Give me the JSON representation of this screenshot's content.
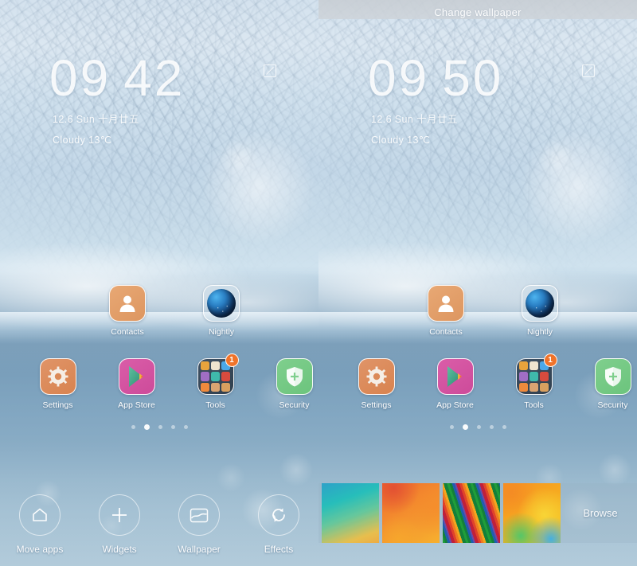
{
  "header": {
    "title": "Change wallpaper"
  },
  "panels": [
    {
      "id": "left",
      "clock": {
        "hours": "09",
        "minutes": "42",
        "date": "12.6 Sun 十月廿五",
        "weather": "Cloudy 13℃"
      }
    },
    {
      "id": "right",
      "clock": {
        "hours": "09",
        "minutes": "50",
        "date": "12.6 Sun 十月廿五",
        "weather": "Cloudy 13℃"
      }
    }
  ],
  "home": {
    "row_top": [
      {
        "label": "Contacts",
        "icon": "contacts-icon",
        "color": "#e0995f"
      },
      {
        "label": "Nightly",
        "icon": "globe-icon",
        "color": "#1f6fb4"
      }
    ],
    "row_bottom": [
      {
        "label": "Settings",
        "icon": "gear-icon",
        "color": "#db8a58"
      },
      {
        "label": "App Store",
        "icon": "play-icon",
        "color": "#d4529f"
      },
      {
        "label": "Tools",
        "icon": "folder-icon",
        "color": "#37475a",
        "badge": "1"
      },
      {
        "label": "Security",
        "icon": "shield-icon",
        "color": "#75c984"
      }
    ],
    "folder_mini_colors": [
      "#e8a33c",
      "#efe4cf",
      "#4ba8e8",
      "#a06ec4",
      "#3fb9ac",
      "#d84b3e",
      "#ef8a3c",
      "#d9a472",
      "#d9a05f"
    ],
    "page_dots": {
      "count": 5,
      "active_index": 1
    }
  },
  "toolbar": {
    "items": [
      {
        "label": "Move apps",
        "icon": "home-icon"
      },
      {
        "label": "Widgets",
        "icon": "plus-icon"
      },
      {
        "label": "Wallpaper",
        "icon": "image-icon"
      },
      {
        "label": "Effects",
        "icon": "refresh-icon"
      }
    ]
  },
  "wallpaper_picker": {
    "thumbnails": [
      {
        "name": "teal-gold-gradient",
        "class": "wp1"
      },
      {
        "name": "orange-circles",
        "class": "wp2"
      },
      {
        "name": "rainbow-stripes",
        "class": "wp3"
      },
      {
        "name": "citrus-circles",
        "class": "wp4"
      }
    ],
    "browse_label": "Browse"
  },
  "status": {
    "edit_icon": "compose-edit-icon"
  }
}
